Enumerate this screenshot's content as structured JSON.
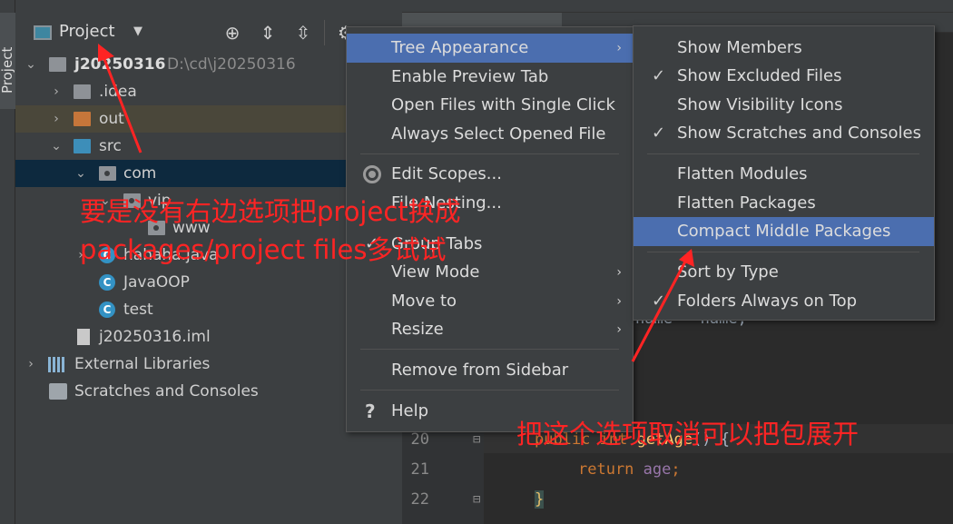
{
  "stripe": {
    "label": "Project"
  },
  "panel": {
    "title": "Project",
    "buttons": [
      "locate",
      "expand-all",
      "collapse-all",
      "options"
    ]
  },
  "tree": {
    "root": {
      "name": "j20250316",
      "path": "D:\\cd\\j20250316"
    },
    "items": [
      {
        "label": ".idea"
      },
      {
        "label": "out"
      },
      {
        "label": "src"
      },
      {
        "label": "com"
      },
      {
        "label": "vip"
      },
      {
        "label": "www"
      },
      {
        "label": "hahaha.java"
      },
      {
        "label": "JavaOOP"
      },
      {
        "label": "test"
      },
      {
        "label": "j20250316.iml"
      },
      {
        "label": "External Libraries"
      },
      {
        "label": "Scratches and Consoles"
      }
    ]
  },
  "menu": {
    "items": [
      {
        "label": "Tree Appearance"
      },
      {
        "label": "Enable Preview Tab"
      },
      {
        "label": "Open Files with Single Click"
      },
      {
        "label": "Always Select Opened File"
      },
      {
        "label": "Edit Scopes..."
      },
      {
        "label": "File Nesting..."
      },
      {
        "label": "Group Tabs"
      },
      {
        "label": "View Mode"
      },
      {
        "label": "Move to"
      },
      {
        "label": "Resize"
      },
      {
        "label": "Remove from Sidebar"
      },
      {
        "label": "Help"
      }
    ]
  },
  "submenu": {
    "items": [
      {
        "label": "Show Members",
        "checked": false
      },
      {
        "label": "Show Excluded Files",
        "checked": true
      },
      {
        "label": "Show Visibility Icons",
        "checked": false
      },
      {
        "label": "Show Scratches and Consoles",
        "checked": true
      },
      {
        "label": "Flatten Modules",
        "checked": false
      },
      {
        "label": "Flatten Packages",
        "checked": false
      },
      {
        "label": "Compact Middle Packages",
        "checked": false
      },
      {
        "label": "Sort by Type",
        "checked": false
      },
      {
        "label": "Folders Always on Top",
        "checked": true
      }
    ]
  },
  "editor": {
    "partial_line": "name = name;",
    "lines": [
      {
        "number": "20",
        "tokens": [
          "public",
          "int",
          "getAge",
          "() {"
        ]
      },
      {
        "number": "21",
        "tokens": [
          "return",
          "age",
          ";"
        ]
      },
      {
        "number": "22",
        "tokens": [
          "}"
        ]
      }
    ]
  },
  "annotations": {
    "left_note_line1": "要是没有右边选项把project换成",
    "left_note_line2": "packages/project files多试试",
    "right_note": "把这个选项取消可以把包展开",
    "color": "#ff2424"
  },
  "colors": {
    "menu_highlight": "#4b6eaf",
    "selected_row": "#0d293e",
    "excluded_row": "#4a473a"
  }
}
